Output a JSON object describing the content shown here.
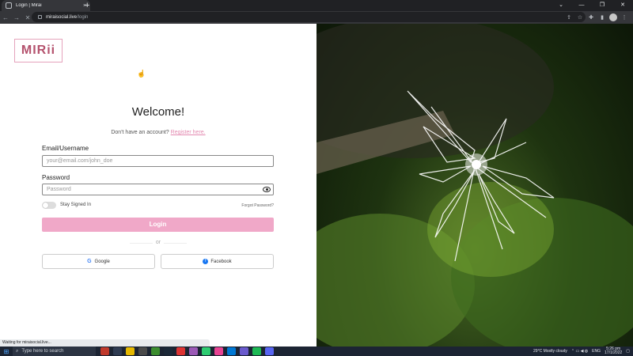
{
  "browser": {
    "tab_title": "Login | Mirai",
    "tab_close": "×",
    "new_tab": "+",
    "window_controls": [
      "⌄",
      "—",
      "❐",
      "✕"
    ],
    "url_host": "miraisocial.live",
    "url_path": "/login",
    "nav": [
      "←",
      "→",
      "✕"
    ]
  },
  "page": {
    "logo_text": "MIRii",
    "welcome": "Welcome!",
    "register_prompt": "Don't have an account?",
    "register_link": "Register here.",
    "email_label": "Email/Username",
    "email_placeholder": "your@email.com/john_doe",
    "password_label": "Password",
    "password_placeholder": "Password",
    "stay_signed_in": "Stay Signed In",
    "forgot_password": "Forgot Password?",
    "login_button": "Login",
    "or_text": "or",
    "google_button": "Google",
    "facebook_button": "Facebook"
  },
  "status_text": "Waiting for miraisocial.live...",
  "taskbar": {
    "search_placeholder": "Type here to search",
    "weather": "29°C  Mostly cloudy",
    "lang": "ENG",
    "time": "5:26 pm",
    "date": "17/1/2022"
  },
  "colors": {
    "accent_pink": "#f0a8c8",
    "link_pink": "#e38ab0",
    "logo_pink": "#b5536e"
  }
}
